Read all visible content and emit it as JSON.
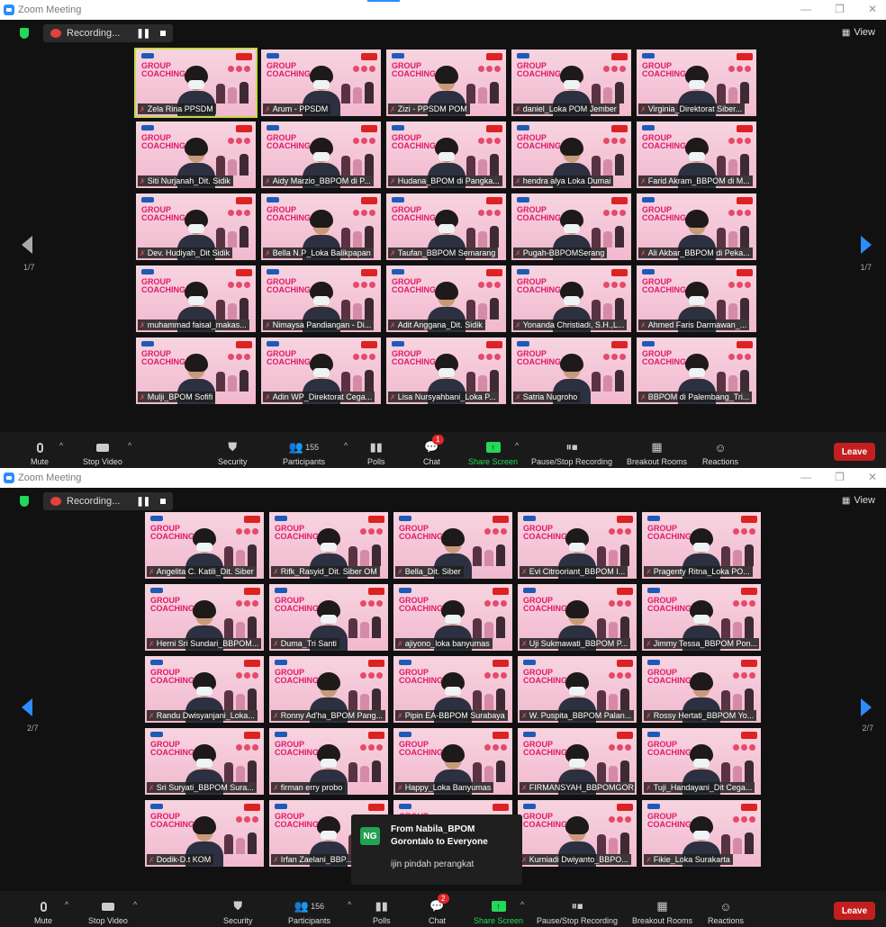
{
  "window1": {
    "title": "Zoom Meeting",
    "recording_label": "Recording...",
    "view_label": "View",
    "page_left": "1/7",
    "page_right": "1/7",
    "participants_count": "155",
    "chat_badge": "1",
    "participants": [
      "Zela Rina PPSDM",
      "Arum - PPSDM",
      "Zizi - PPSDM POM",
      "daniel_Loka POM Jember",
      "Virginia_Direktorat Siber...",
      "Siti Nurjanah_Dit. Sidik",
      "Aidy Marzio_BBPOM di P...",
      "Hudana_BPOM di Pangka...",
      "hendra alya Loka Dumai",
      "Farid Akram_BBPOM di M...",
      "Dev. Hudiyah_Dit Sidik",
      "Bella N.P_Loka Balikpapan",
      "Taufan_BBPOM Semarang",
      "Pugah-BBPOMSerang",
      "Ali Akbar_BBPOM di Peka...",
      "muhammad faisal_makas...",
      "Nimaysa Pandiangan - Di...",
      "Adit Anggana_Dit. Sidik",
      "Yonanda Christiadi, S.H.,L...",
      "Ahmed Faris Darmawan_...",
      "Mulji_BPOM Sofifi",
      "Adin WP_Direktorat Cega...",
      "Lisa Nursyahbani_Loka P...",
      "Satria Nugroho",
      "BBPOM di Palembang_Tri..."
    ]
  },
  "window2": {
    "title": "Zoom Meeting",
    "recording_label": "Recording...",
    "view_label": "View",
    "page_left": "2/7",
    "page_right": "2/7",
    "participants_count": "156",
    "chat_badge": "2",
    "participants": [
      "Angelita C. Katili_Dit. Siber",
      "Rifk_Rasyid_Dit. Siber OM",
      "Bella_Dit. Siber",
      "Evi Citrooriant_BBPOM I...",
      "Pragenty Ritna_Loka PO...",
      "Herni Sri Sundari_BBPOM...",
      "Duma_Tri Santi",
      "ajiyono_loka banyumas",
      "Uji Sukmawati_BBPOM P...",
      "Jimmy Tessa_BBPOM Pon...",
      "Randu Dwisyanjani_Loka...",
      "Ronny Ad'ha_BPOM Pang...",
      "Pipin EA-BBPOM Surabaya",
      "W. Puspita_BBPOM Palan...",
      "Rossy Hertati_BBPOM Yo...",
      "Sri Suryati_BBPOM Sura...",
      "firman erry probo",
      "Happy_Loka Banyumas",
      "FIRMANSYAH_BBPOMGOR...",
      "Tuji_Handayani_Dit Cega...",
      "Dodik-D.t KOM",
      "Irfan Zaelani_BBP...",
      "",
      "Kurniadi Dwiyanto_BBPO...",
      "Fikie_Loka Surakarta"
    ],
    "chat_popup": {
      "initials": "NG",
      "from_line1": "From Nabila_BPOM",
      "from_line2": "Gorontalo to Everyone",
      "message": "ijin pindah perangkat"
    }
  },
  "toolbar": {
    "mute": "Mute",
    "stop_video": "Stop Video",
    "security": "Security",
    "participants": "Participants",
    "polls": "Polls",
    "chat": "Chat",
    "share_screen": "Share Screen",
    "pause_recording": "Pause/Stop Recording",
    "breakout": "Breakout Rooms",
    "reactions": "Reactions",
    "leave": "Leave"
  },
  "background_text": {
    "line1": "GROUP",
    "line2": "COACHING"
  },
  "colors": {
    "accent": "#2d8cff",
    "share_green": "#23d959",
    "leave_red": "#c41f1f",
    "active_speaker": "#c5d94a"
  }
}
